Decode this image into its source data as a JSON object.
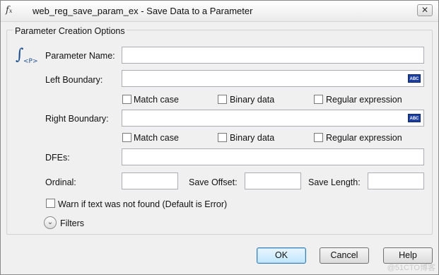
{
  "window": {
    "title_icon": "function-icon",
    "title": "web_reg_save_param_ex - Save Data to a Parameter",
    "close_glyph": "✕"
  },
  "group": {
    "label": "Parameter Creation Options"
  },
  "param_icon": {
    "glyph": "∫",
    "sub": "<P>"
  },
  "fields": {
    "parameter_name": {
      "label": "Parameter Name:",
      "value": ""
    },
    "left_boundary": {
      "label": "Left Boundary:",
      "value": "",
      "button": "ABC"
    },
    "right_boundary": {
      "label": "Right Boundary:",
      "value": "",
      "button": "ABC"
    },
    "dfes": {
      "label": "DFEs:",
      "value": ""
    },
    "ordinal": {
      "label": "Ordinal:",
      "value": ""
    },
    "save_offset": {
      "label": "Save Offset:",
      "value": ""
    },
    "save_length": {
      "label": "Save Length:",
      "value": ""
    }
  },
  "left_options": {
    "match_case": "Match case",
    "binary_data": "Binary data",
    "regular_expression": "Regular expression"
  },
  "right_options": {
    "match_case": "Match case",
    "binary_data": "Binary data",
    "regular_expression": "Regular expression"
  },
  "warn": {
    "label": "Warn if text was not found (Default is Error)",
    "checked": false
  },
  "filters": {
    "label": "Filters",
    "glyph": "⌄"
  },
  "buttons": {
    "ok": "OK",
    "cancel": "Cancel",
    "help": "Help"
  },
  "watermark": "@51CTO博客"
}
